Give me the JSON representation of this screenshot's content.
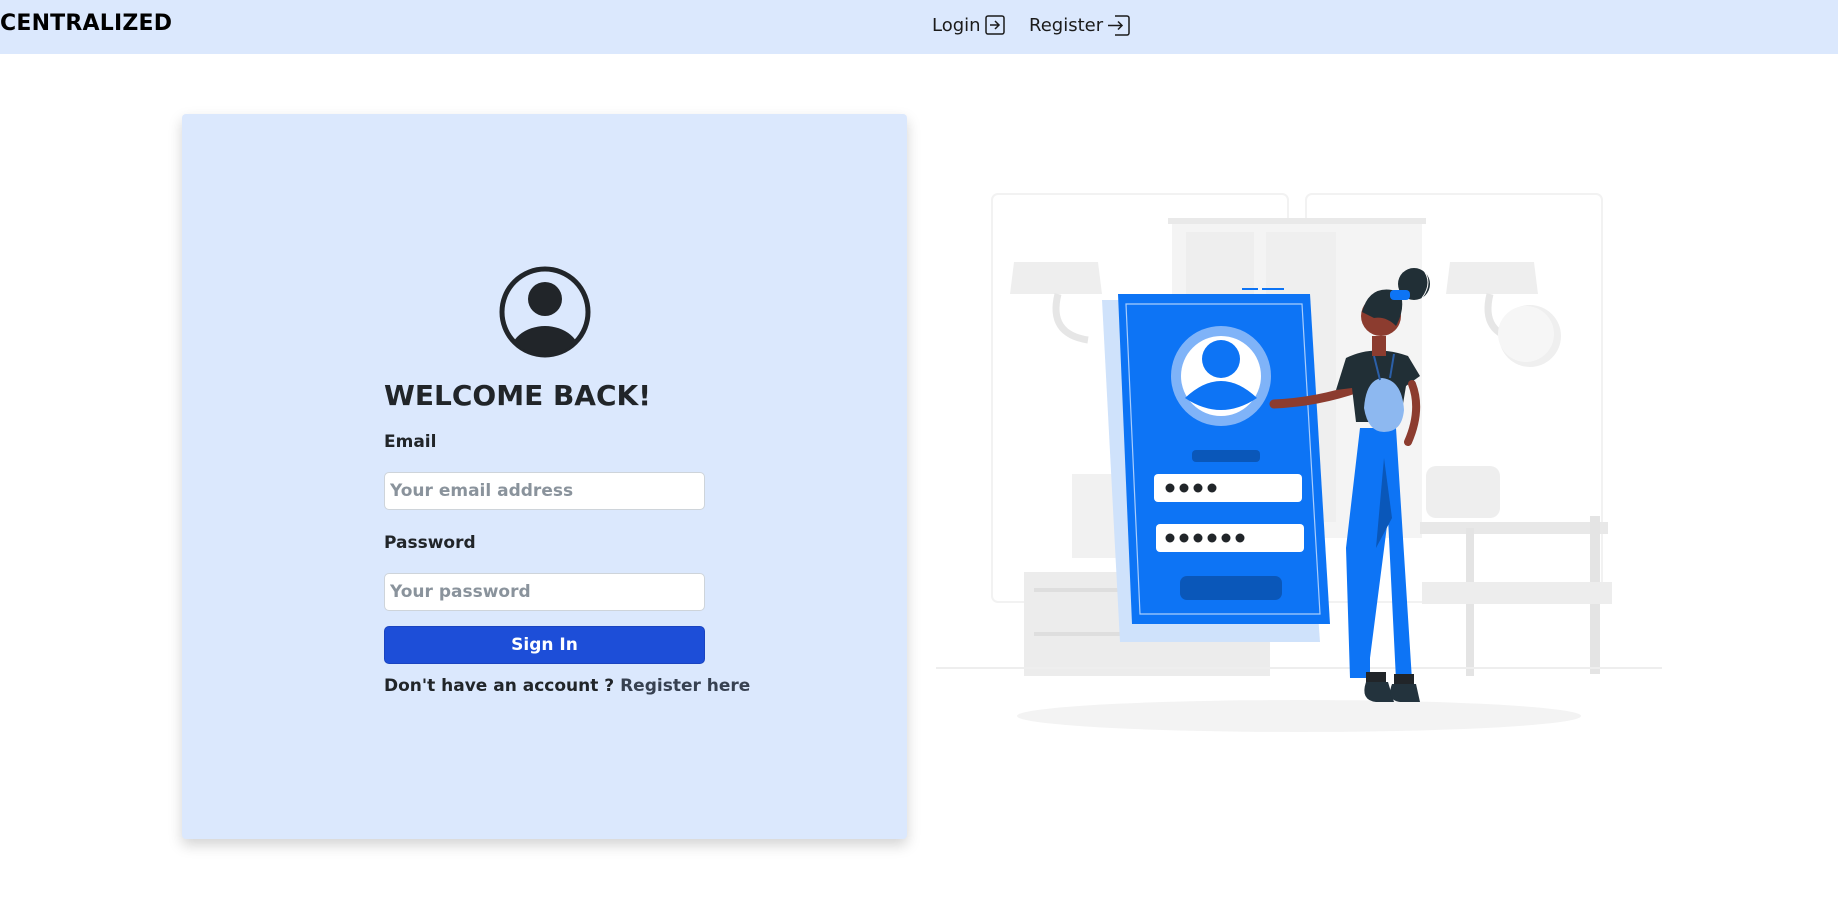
{
  "navbar": {
    "brand": "CENTRALIZED",
    "login_label": "Login",
    "register_label": "Register",
    "login_icon": "box-arrow-in-right-icon",
    "register_icon": "box-arrow-in-right-icon"
  },
  "login_form": {
    "avatar_icon": "person-circle-icon",
    "title": "WELCOME BACK!",
    "email_label": "Email",
    "email_placeholder": "Your email address",
    "email_value": "",
    "password_label": "Password",
    "password_placeholder": "Your password",
    "password_value": "",
    "submit_label": "Sign In",
    "register_prompt": "Don't have an account ?",
    "register_link": "Register here"
  },
  "colors": {
    "nav_background": "#dbe8fd",
    "card_background": "#dbe8fd",
    "primary_button": "#1d4ed8",
    "illustration_accent": "#0d74f5"
  }
}
